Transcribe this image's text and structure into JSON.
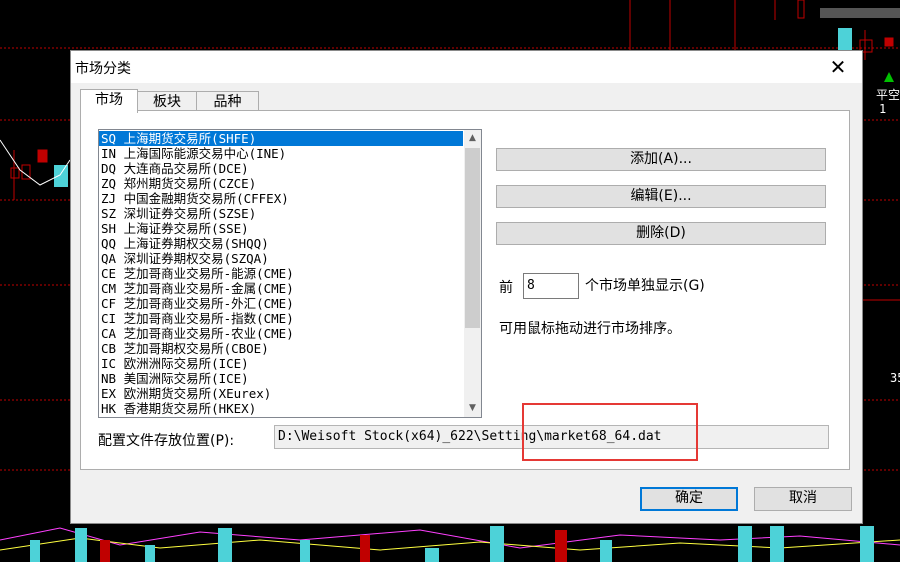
{
  "dialog": {
    "title": "市场分类",
    "tabs": [
      "市场",
      "板块",
      "品种"
    ],
    "markets": [
      "SQ  上海期货交易所(SHFE)",
      "IN  上海国际能源交易中心(INE)",
      "DQ  大连商品交易所(DCE)",
      "ZQ  郑州期货交易所(CZCE)",
      "ZJ  中国金融期货交易所(CFFEX)",
      "SZ  深圳证券交易所(SZSE)",
      "SH  上海证券交易所(SSE)",
      "QQ  上海证券期权交易(SHQQ)",
      "QA  深圳证券期权交易(SZQA)",
      "CE  芝加哥商业交易所-能源(CME)",
      "CM  芝加哥商业交易所-金属(CME)",
      "CF  芝加哥商业交易所-外汇(CME)",
      "CI  芝加哥商业交易所-指数(CME)",
      "CA  芝加哥商业交易所-农业(CME)",
      "CB  芝加哥期权交易所(CBOE)",
      "IC  欧洲洲际交易所(ICE)",
      "NB  美国洲际交易所(ICE)",
      "EX  欧洲期货交易所(XEurex)",
      "HK  香港期货交易所(HKEX)"
    ],
    "buttons": {
      "add": "添加(A)...",
      "edit": "编辑(E)...",
      "delete": "删除(D)",
      "ok": "确定",
      "cancel": "取消"
    },
    "count_prefix": "前",
    "count_value": "8",
    "count_suffix": "个市场单独显示(G)",
    "hint": "可用鼠标拖动进行市场排序。",
    "config_label": "配置文件存放位置(P):",
    "config_path": "D:\\Weisoft Stock(x64)_622\\Setting\\market68_64.dat"
  },
  "background": {
    "right_labels": [
      "平空",
      "1",
      "35"
    ]
  }
}
